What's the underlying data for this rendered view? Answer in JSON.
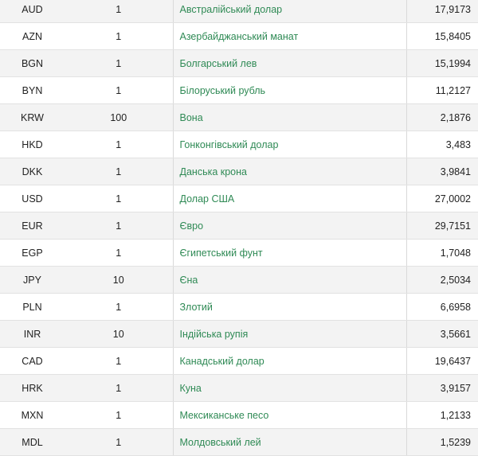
{
  "rates": [
    {
      "code": "AUD",
      "units": "1",
      "name": "Австралійський долар",
      "rate": "17,9173"
    },
    {
      "code": "AZN",
      "units": "1",
      "name": "Азербайджанський манат",
      "rate": "15,8405"
    },
    {
      "code": "BGN",
      "units": "1",
      "name": "Болгарський лев",
      "rate": "15,1994"
    },
    {
      "code": "BYN",
      "units": "1",
      "name": "Білоруський рубль",
      "rate": "11,2127"
    },
    {
      "code": "KRW",
      "units": "100",
      "name": "Вона",
      "rate": "2,1876"
    },
    {
      "code": "HKD",
      "units": "1",
      "name": "Гонконгівський долар",
      "rate": "3,483"
    },
    {
      "code": "DKK",
      "units": "1",
      "name": "Данська крона",
      "rate": "3,9841"
    },
    {
      "code": "USD",
      "units": "1",
      "name": "Долар США",
      "rate": "27,0002"
    },
    {
      "code": "EUR",
      "units": "1",
      "name": "Євро",
      "rate": "29,7151"
    },
    {
      "code": "EGP",
      "units": "1",
      "name": "Єгипетський фунт",
      "rate": "1,7048"
    },
    {
      "code": "JPY",
      "units": "10",
      "name": "Єна",
      "rate": "2,5034"
    },
    {
      "code": "PLN",
      "units": "1",
      "name": "Злотий",
      "rate": "6,6958"
    },
    {
      "code": "INR",
      "units": "10",
      "name": "Індійська рупія",
      "rate": "3,5661"
    },
    {
      "code": "CAD",
      "units": "1",
      "name": "Канадський долар",
      "rate": "19,6437"
    },
    {
      "code": "HRK",
      "units": "1",
      "name": "Куна",
      "rate": "3,9157"
    },
    {
      "code": "MXN",
      "units": "1",
      "name": "Мексиканське песо",
      "rate": "1,2133"
    },
    {
      "code": "MDL",
      "units": "1",
      "name": "Молдовський лей",
      "rate": "1,5239"
    }
  ],
  "colors": {
    "link": "#2f8a55",
    "row_alt": "#f3f3f3",
    "border": "#e2e2e2"
  }
}
